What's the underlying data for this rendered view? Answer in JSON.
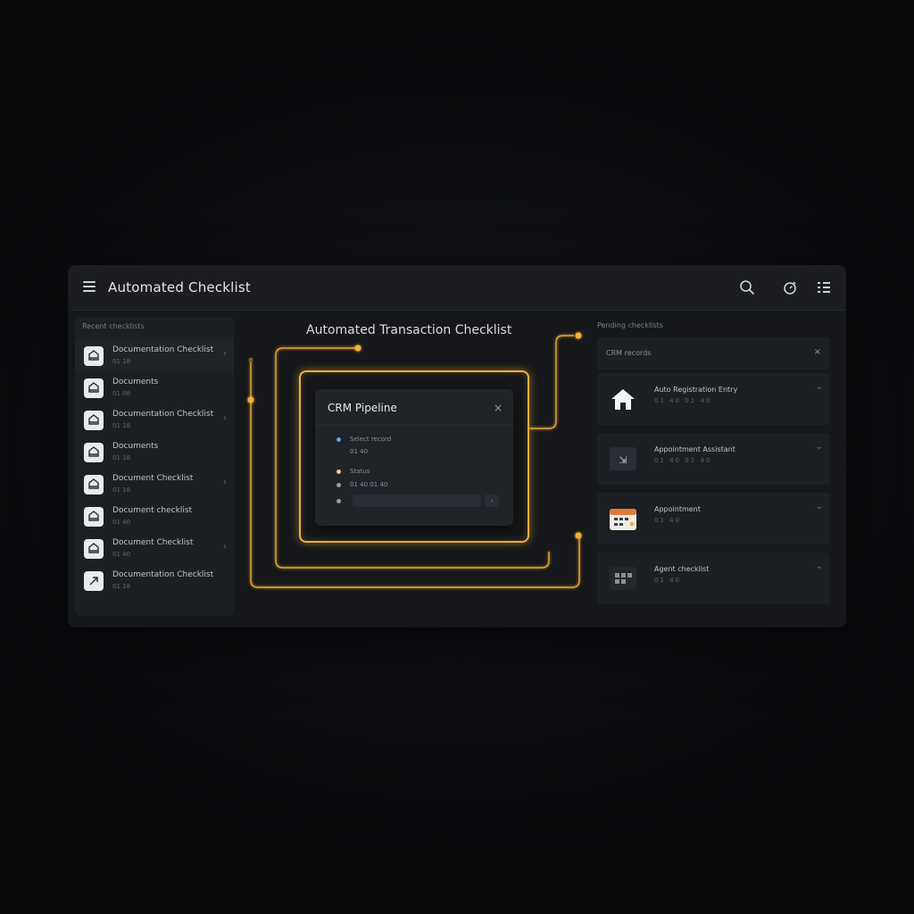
{
  "app": {
    "title": "Automated Checklist"
  },
  "sidebar": {
    "header": "Recent checklists",
    "items": [
      {
        "title": "Documentation Checklist",
        "sub": "01 18",
        "chevron": "›"
      },
      {
        "title": "Documents",
        "sub": "01 08",
        "chevron": ""
      },
      {
        "title": "Documentation Checklist",
        "sub": "01 18",
        "chevron": "›"
      },
      {
        "title": "Documents",
        "sub": "01 18",
        "chevron": ""
      },
      {
        "title": "Document Checklist",
        "sub": "01 18",
        "chevron": "›"
      },
      {
        "title": "Document checklist",
        "sub": "01 40",
        "chevron": ""
      },
      {
        "title": "Document Checklist",
        "sub": "01 40",
        "chevron": "›"
      },
      {
        "title": "Documentation Checklist",
        "sub": "01 18",
        "chevron": ""
      }
    ]
  },
  "center": {
    "title": "Automated Transaction Checklist",
    "dialog": {
      "title": "CRM Pipeline",
      "close": "×",
      "rows": [
        {
          "text": "Select record",
          "color": "#5aa7e6"
        },
        {
          "text": "01 40",
          "color": "#9a9ea4"
        },
        {
          "text": "Status",
          "color": "#e6d27a"
        },
        {
          "text": "01 40 01 40",
          "color": "#9a9ea4"
        },
        {
          "text": "",
          "color": "#9a9ea4"
        }
      ],
      "input_button": "›"
    }
  },
  "right": {
    "header": "Pending checklists",
    "filter": {
      "text": "CRM records",
      "close": "×"
    },
    "cards": [
      {
        "title": "Auto Registration Entry",
        "sub": "01 40 01 40",
        "icon": "house-icon"
      },
      {
        "title": "Appointment Assistant",
        "sub": "01 40 01 40",
        "icon": "arrow-icon"
      },
      {
        "title": "Appointment",
        "sub": "01 40",
        "icon": "calendar-icon"
      },
      {
        "title": "Agent checklist",
        "sub": "01 40",
        "icon": "grid-icon"
      }
    ]
  },
  "colors": {
    "accent": "#f2b23a",
    "background": "#0b0c0e",
    "panel": "#1c1f23"
  }
}
